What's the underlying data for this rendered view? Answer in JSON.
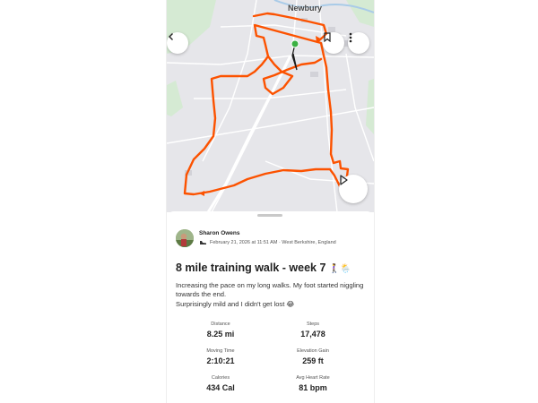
{
  "map": {
    "town_label": "Newbury",
    "route_color": "#fc5200",
    "start_color": "#3bb143"
  },
  "controls": {
    "back_icon": "chevron-left-icon",
    "bookmark_icon": "bookmark-icon",
    "more_icon": "vertical-ellipsis-icon",
    "play_icon": "play-icon"
  },
  "activity": {
    "athlete_name": "Sharon Owens",
    "activity_type_icon": "shoe-icon",
    "datetime_location": "February 21, 2026 at 11:51 AM · West Berkshire, England",
    "title": "8 mile training walk - week 7",
    "title_emoji": "🚶‍♀️🌦️",
    "description_line1": "Increasing the pace on my long walks. My foot started niggling towards the end.",
    "description_line2": "Surprisingly mild and I didn't get lost 😂"
  },
  "stats": [
    {
      "label": "Distance",
      "value": "8.25 mi"
    },
    {
      "label": "Steps",
      "value": "17,478"
    },
    {
      "label": "Moving Time",
      "value": "2:10:21"
    },
    {
      "label": "Elevation Gain",
      "value": "259 ft"
    },
    {
      "label": "Calories",
      "value": "434 Cal"
    },
    {
      "label": "Avg Heart Rate",
      "value": "81 bpm"
    }
  ]
}
